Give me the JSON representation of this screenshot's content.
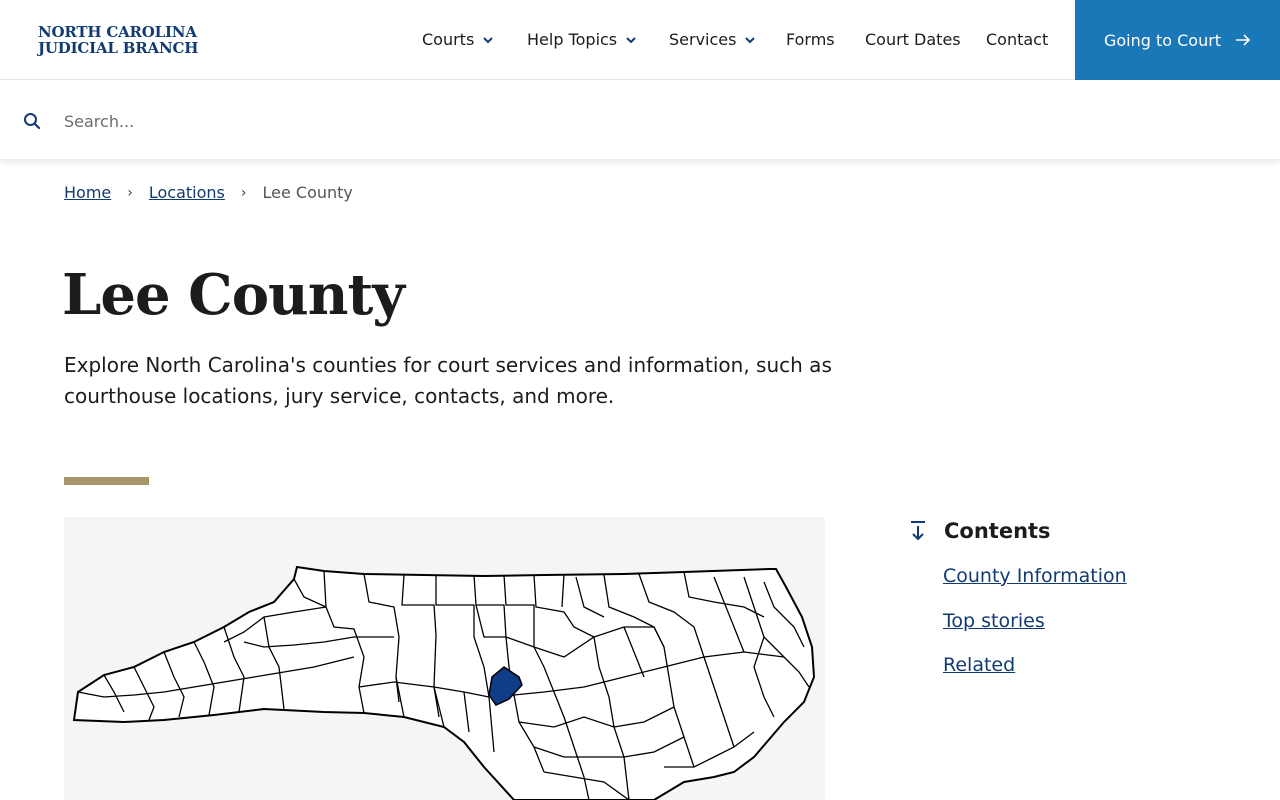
{
  "header": {
    "logo_line1": "NORTH CAROLINA",
    "logo_line2": "JUDICIAL BRANCH",
    "nav": [
      {
        "label": "Courts",
        "dropdown": true
      },
      {
        "label": "Help Topics",
        "dropdown": true
      },
      {
        "label": "Services",
        "dropdown": true
      },
      {
        "label": "Forms",
        "dropdown": false
      },
      {
        "label": "Court Dates",
        "dropdown": false
      },
      {
        "label": "Contact",
        "dropdown": false
      }
    ],
    "cta_label": "Going to Court"
  },
  "search": {
    "placeholder": "Search...",
    "value": ""
  },
  "breadcrumb": {
    "items": [
      "Home",
      "Locations"
    ],
    "current": "Lee County"
  },
  "page": {
    "title": "Lee County",
    "intro": "Explore North Carolina's counties for court services and information, such as courthouse locations, jury service, contacts, and more."
  },
  "map": {
    "highlight_color": "#0f3d87",
    "outline_color": "#000000",
    "fill_color": "#ffffff",
    "background": "#f5f5f5"
  },
  "contents": {
    "title": "Contents",
    "links": [
      "County Information",
      "Top stories",
      "Related"
    ]
  },
  "colors": {
    "brand_navy": "#123a73",
    "cta_blue": "#1a77b8",
    "accent_tan": "#a8946b"
  },
  "icons": {
    "search": "search-icon",
    "chevron": "chevron-down-icon",
    "arrow": "arrow-right-icon",
    "contents": "arrow-down-to-line-icon"
  }
}
